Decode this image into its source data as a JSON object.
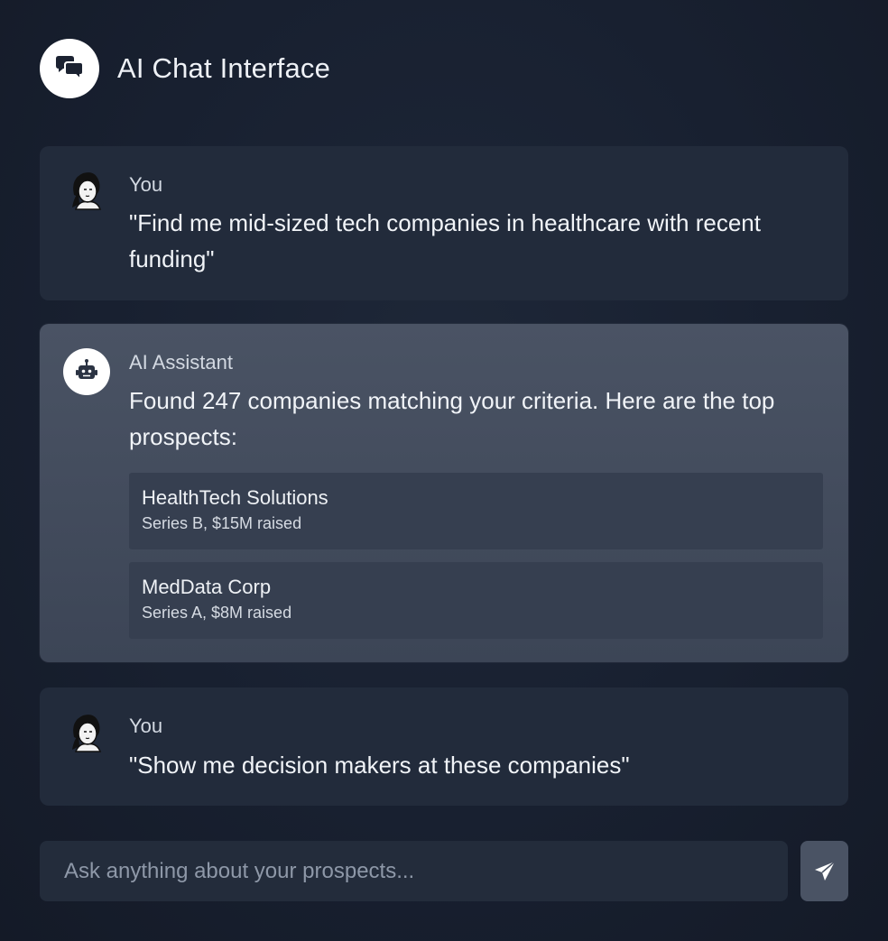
{
  "header": {
    "title": "AI Chat Interface",
    "icon": "chat-bubbles-icon"
  },
  "messages": [
    {
      "role": "user",
      "sender": "You",
      "avatar": "person-avatar-icon",
      "text": "\"Find me mid-sized tech companies in healthcare with recent funding\""
    },
    {
      "role": "assistant",
      "sender": "AI Assistant",
      "avatar": "robot-icon",
      "text": "Found 247 companies matching your criteria. Here are the top prospects:",
      "companies": [
        {
          "name": "HealthTech Solutions",
          "detail": "Series B, $15M raised"
        },
        {
          "name": "MedData Corp",
          "detail": "Series A, $8M raised"
        }
      ]
    },
    {
      "role": "user",
      "sender": "You",
      "avatar": "person-avatar-icon",
      "text": "\"Show me decision makers at these companies\""
    }
  ],
  "composer": {
    "placeholder": "Ask anything about your prospects...",
    "value": "",
    "send_icon": "send-icon"
  },
  "colors": {
    "background": "#182030",
    "user_bubble": "#222b3b",
    "assistant_bubble": "#454e5f",
    "company_card": "#363f50",
    "send_button": "#4a5364"
  }
}
